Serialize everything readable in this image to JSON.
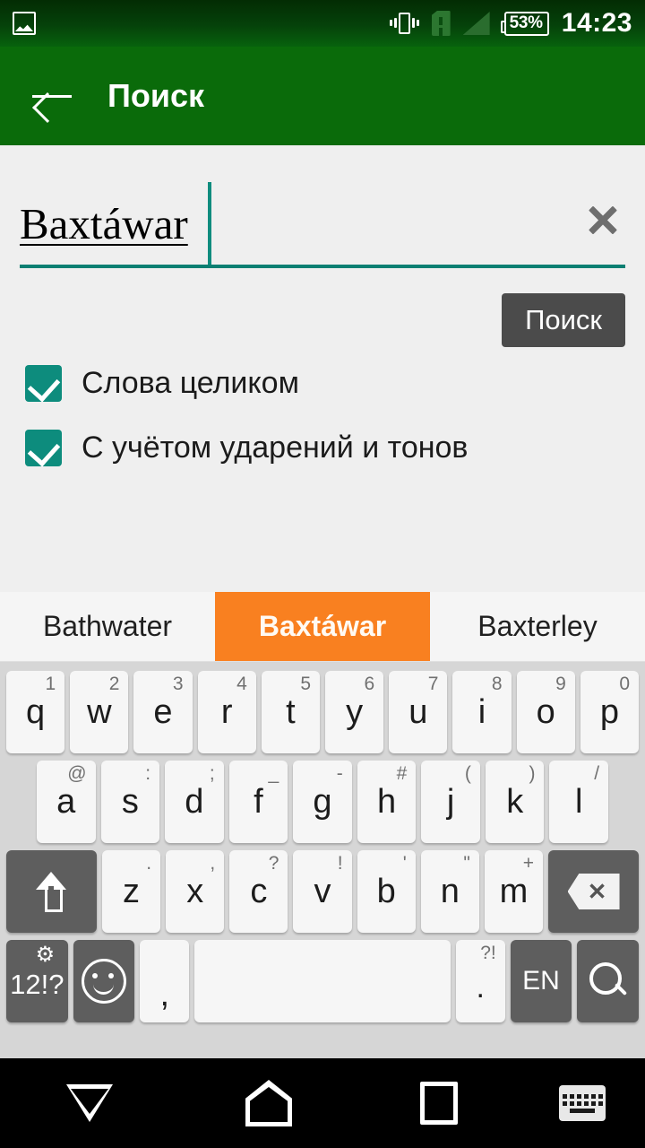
{
  "statusbar": {
    "notification_icon": "image-icon",
    "vibrate_icon": "vibrate-icon",
    "sim_icon": "sim-card-alert-icon",
    "signal_icon": "signal-no-service-icon",
    "battery_level": "53%",
    "time": "14:23"
  },
  "appbar": {
    "back_icon": "back-arrow-icon",
    "title": "Поиск",
    "background_color": "#0a6b0a"
  },
  "search": {
    "query": "Baxtáwar",
    "clear_icon": "clear-x-icon",
    "underline_color": "#0b7f72",
    "caret_color": "#0f8c7e",
    "button_label": "Поиск",
    "button_color": "#4b4b4b",
    "options": [
      {
        "label": "Слова целиком",
        "checked": true
      },
      {
        "label": "С учётом ударений и тонов",
        "checked": true
      }
    ],
    "checkbox_color": "#0d8c7d"
  },
  "suggestions": {
    "highlight_color": "#f98020",
    "items": [
      {
        "label": "Bathwater",
        "active": false
      },
      {
        "label": "Baxtáwar",
        "active": true
      },
      {
        "label": "Baxterley",
        "active": false
      }
    ]
  },
  "keyboard": {
    "row1": [
      {
        "main": "q",
        "hint": "1"
      },
      {
        "main": "w",
        "hint": "2"
      },
      {
        "main": "e",
        "hint": "3"
      },
      {
        "main": "r",
        "hint": "4"
      },
      {
        "main": "t",
        "hint": "5"
      },
      {
        "main": "y",
        "hint": "6"
      },
      {
        "main": "u",
        "hint": "7"
      },
      {
        "main": "i",
        "hint": "8"
      },
      {
        "main": "o",
        "hint": "9"
      },
      {
        "main": "p",
        "hint": "0"
      }
    ],
    "row2": [
      {
        "main": "a",
        "hint": "@"
      },
      {
        "main": "s",
        "hint": ":"
      },
      {
        "main": "d",
        "hint": ";"
      },
      {
        "main": "f",
        "hint": "_"
      },
      {
        "main": "g",
        "hint": "-"
      },
      {
        "main": "h",
        "hint": "#"
      },
      {
        "main": "j",
        "hint": "("
      },
      {
        "main": "k",
        "hint": ")"
      },
      {
        "main": "l",
        "hint": "/"
      }
    ],
    "row3": [
      {
        "main": "z",
        "hint": "."
      },
      {
        "main": "x",
        "hint": ","
      },
      {
        "main": "c",
        "hint": "?"
      },
      {
        "main": "v",
        "hint": "!"
      },
      {
        "main": "b",
        "hint": "'"
      },
      {
        "main": "n",
        "hint": "\""
      },
      {
        "main": "m",
        "hint": "+"
      }
    ],
    "shift_icon": "shift-arrow-icon",
    "backspace_icon": "backspace-icon",
    "symbols_label": "12!?",
    "symbols_gear_icon": "gear-icon",
    "emoji_icon": "emoji-smiley-icon",
    "comma_label": ",",
    "space_label": "",
    "period_label": ".",
    "period_hint": "?!",
    "language_label": "EN",
    "search_icon": "search-magnifier-icon",
    "key_color": "#f6f6f6",
    "modifier_color": "#5e5e5e",
    "background_color": "#d6d6d6"
  },
  "navbar": {
    "back_icon": "nav-back-triangle-icon",
    "home_icon": "nav-home-icon",
    "recents_icon": "nav-recents-square-icon",
    "keyboard_icon": "nav-keyboard-icon"
  }
}
